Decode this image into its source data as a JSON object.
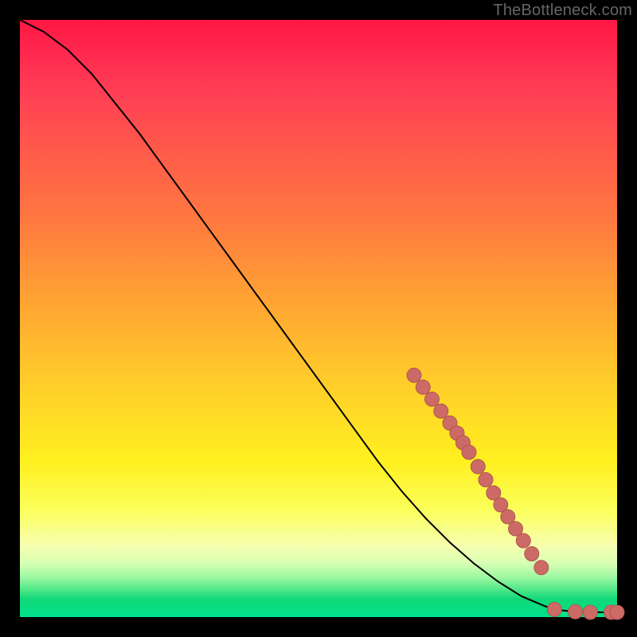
{
  "watermark": "TheBottleneck.com",
  "colors": {
    "curve": "#000000",
    "marker_fill": "#cc6b66",
    "marker_stroke": "#b05550"
  },
  "chart_data": {
    "type": "line",
    "title": "",
    "xlabel": "",
    "ylabel": "",
    "xlim": [
      0,
      100
    ],
    "ylim": [
      0,
      100
    ],
    "grid": false,
    "legend": false,
    "series": [
      {
        "name": "curve",
        "x": [
          0,
          4,
          8,
          12,
          16,
          20,
          24,
          28,
          32,
          36,
          40,
          44,
          48,
          52,
          56,
          60,
          64,
          68,
          72,
          76,
          80,
          84,
          88,
          90,
          93,
          96,
          100
        ],
        "y": [
          100,
          98,
          95,
          91,
          86,
          81,
          75.5,
          70,
          64.5,
          59,
          53.5,
          48,
          42.5,
          37,
          31.5,
          26,
          21,
          16.5,
          12.5,
          9,
          6,
          3.5,
          1.8,
          1.2,
          0.9,
          0.8,
          0.8
        ]
      }
    ],
    "markers": [
      {
        "x": 66.0,
        "y": 40.5
      },
      {
        "x": 67.5,
        "y": 38.5
      },
      {
        "x": 69.0,
        "y": 36.5
      },
      {
        "x": 70.5,
        "y": 34.5
      },
      {
        "x": 72.0,
        "y": 32.5
      },
      {
        "x": 73.2,
        "y": 30.8
      },
      {
        "x": 74.2,
        "y": 29.2
      },
      {
        "x": 75.2,
        "y": 27.6
      },
      {
        "x": 76.7,
        "y": 25.2
      },
      {
        "x": 78.0,
        "y": 23.0
      },
      {
        "x": 79.3,
        "y": 20.8
      },
      {
        "x": 80.5,
        "y": 18.8
      },
      {
        "x": 81.7,
        "y": 16.8
      },
      {
        "x": 83.0,
        "y": 14.8
      },
      {
        "x": 84.3,
        "y": 12.8
      },
      {
        "x": 85.7,
        "y": 10.6
      },
      {
        "x": 87.3,
        "y": 8.3
      },
      {
        "x": 89.5,
        "y": 1.3
      },
      {
        "x": 93.0,
        "y": 0.9
      },
      {
        "x": 95.5,
        "y": 0.8
      },
      {
        "x": 99.0,
        "y": 0.8
      },
      {
        "x": 100.0,
        "y": 0.8
      }
    ],
    "marker_radius_frac": 0.012
  }
}
